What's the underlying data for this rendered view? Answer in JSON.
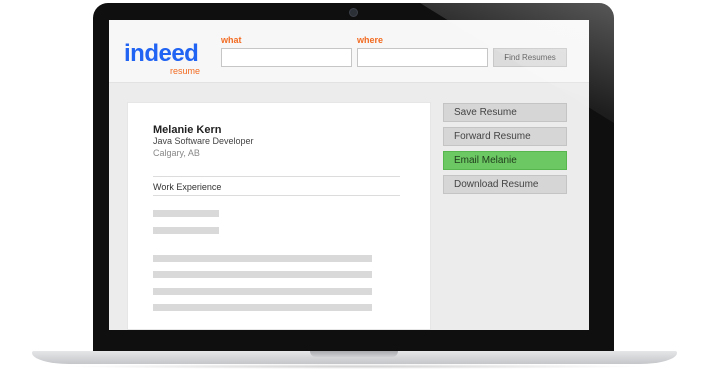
{
  "header": {
    "logo_text": "indeed",
    "logo_sub": "resume",
    "what_label": "what",
    "where_label": "where",
    "what_value": "",
    "where_value": "",
    "find_button": "Find Resumes"
  },
  "resume": {
    "name": "Melanie Kern",
    "title": "Java Software Developer",
    "location": "Calgary, AB",
    "section_heading": "Work Experience"
  },
  "actions": {
    "save": "Save Resume",
    "forward": "Forward Resume",
    "email": "Email Melanie",
    "download": "Download Resume"
  },
  "colors": {
    "brand_blue": "#2164f3",
    "brand_orange": "#f26b21",
    "email_green": "#6cc863"
  }
}
